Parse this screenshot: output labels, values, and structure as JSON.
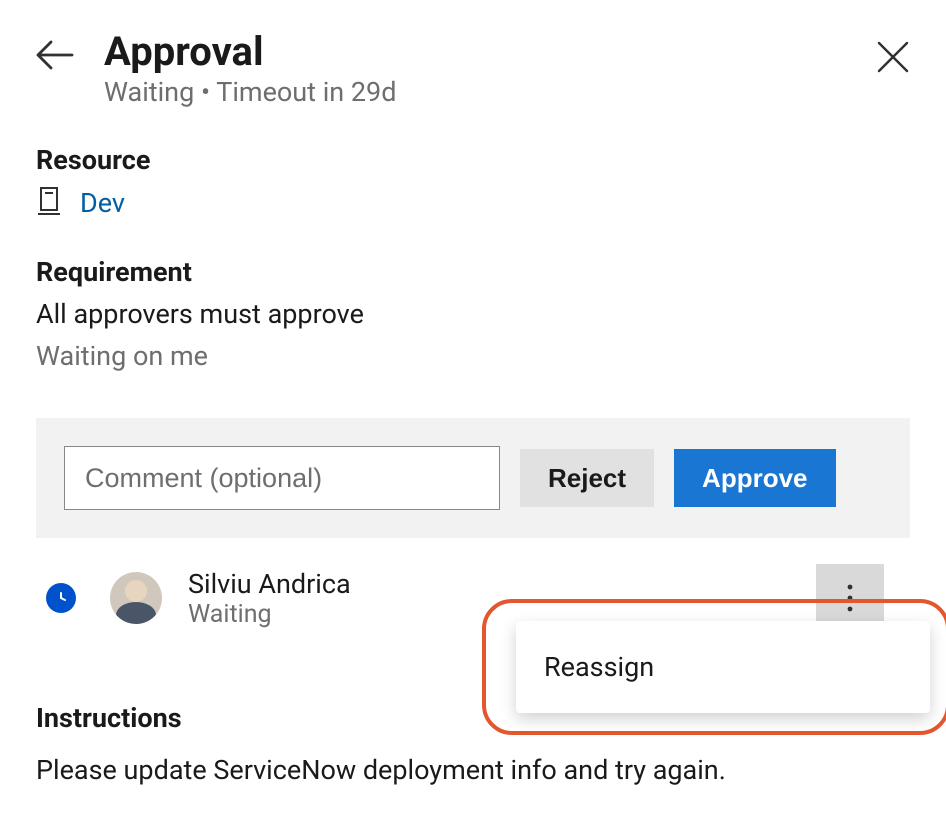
{
  "header": {
    "title": "Approval",
    "subtitle": "Waiting  •  Timeout in 29d"
  },
  "resource": {
    "section_title": "Resource",
    "name": "Dev"
  },
  "requirement": {
    "section_title": "Requirement",
    "policy": "All approvers must approve",
    "status": "Waiting on me"
  },
  "action": {
    "comment_placeholder": "Comment (optional)",
    "reject_label": "Reject",
    "approve_label": "Approve"
  },
  "approver": {
    "name": "Silviu Andrica",
    "status": "Waiting"
  },
  "menu": {
    "reassign_label": "Reassign"
  },
  "instructions": {
    "section_title": "Instructions",
    "text": "Please update ServiceNow deployment info and try again."
  }
}
